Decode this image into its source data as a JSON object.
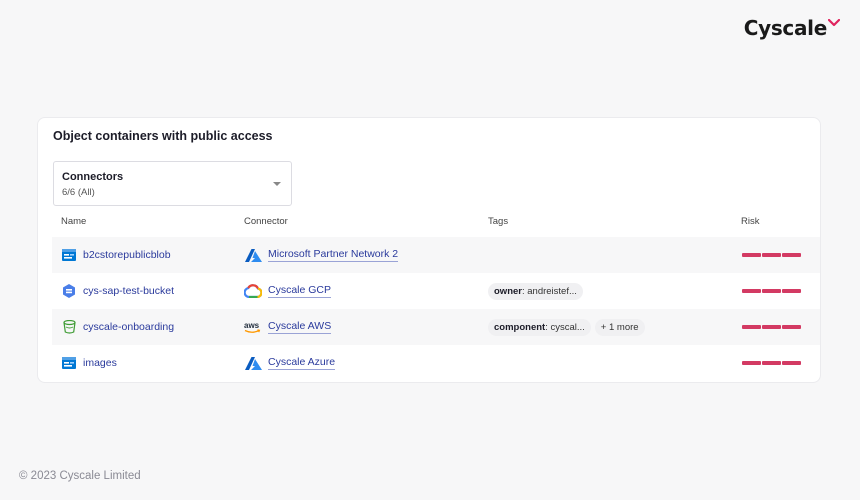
{
  "brand": {
    "name": "Cyscale",
    "accent": "#e0245e"
  },
  "widget": {
    "title": "Object containers with public access",
    "filter": {
      "label": "Connectors",
      "value": "6/6 (All)"
    },
    "columns": {
      "name": "Name",
      "connector": "Connector",
      "tags": "Tags",
      "risk": "Risk"
    },
    "rows": [
      {
        "name": "b2cstorepublicblob",
        "name_icon": "azure-storage-icon",
        "connector": "Microsoft Partner Network 2",
        "connector_icon": "azure-icon",
        "tags": [],
        "risk": "high"
      },
      {
        "name": "cys-sap-test-bucket",
        "name_icon": "gcp-storage-icon",
        "connector": "Cyscale GCP",
        "connector_icon": "gcp-icon",
        "tags": [
          {
            "key": "owner",
            "value": ": andreistef..."
          }
        ],
        "risk": "high"
      },
      {
        "name": "cyscale-onboarding",
        "name_icon": "s3-bucket-icon",
        "connector": "Cyscale AWS",
        "connector_icon": "aws-icon",
        "tags": [
          {
            "key": "component",
            "value": ": cyscal..."
          }
        ],
        "more": "+ 1 more",
        "risk": "high"
      },
      {
        "name": "images",
        "name_icon": "azure-storage-icon",
        "connector": "Cyscale Azure",
        "connector_icon": "azure-icon",
        "tags": [],
        "risk": "high"
      }
    ]
  },
  "colors": {
    "link": "#2a3a9c",
    "risk_high": "#d33a63"
  },
  "footer": "© 2023 Cyscale Limited"
}
